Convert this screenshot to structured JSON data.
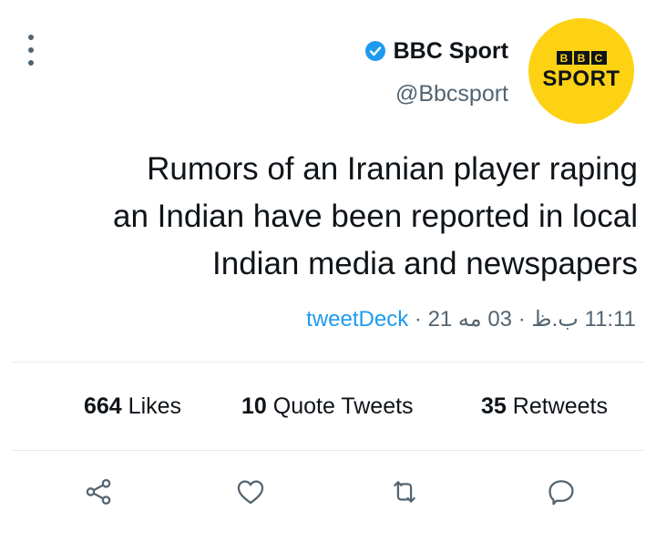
{
  "author": {
    "display_name": "BBC Sport",
    "handle": "@Bbcsport",
    "verified_icon": "verified-badge-icon",
    "avatar": {
      "blocks": [
        "B",
        "B",
        "C"
      ],
      "word": "SPORT",
      "background": "#fdd213"
    }
  },
  "tweet": {
    "text": "Rumors of an Iranian player raping\nan Indian have been reported in local\nIndian media and newspapers",
    "time": "11:11 ب.ظ",
    "date": "03 مه 21",
    "separator": "·",
    "source": "tweetDeck"
  },
  "stats": {
    "retweets": {
      "count": "35",
      "label": "Retweets"
    },
    "quotes": {
      "count": "10",
      "label": "Quote Tweets"
    },
    "likes": {
      "count": "664",
      "label": "Likes"
    }
  },
  "actions": {
    "reply_icon": "reply-icon",
    "retweet_icon": "retweet-icon",
    "like_icon": "heart-icon",
    "share_icon": "share-icon"
  },
  "menu": {
    "icon": "more-vertical-icon"
  },
  "colors": {
    "accent": "#1d9bf0",
    "secondary_text": "#536471",
    "primary_text": "#0f1419",
    "divider": "#e6e9ec"
  }
}
